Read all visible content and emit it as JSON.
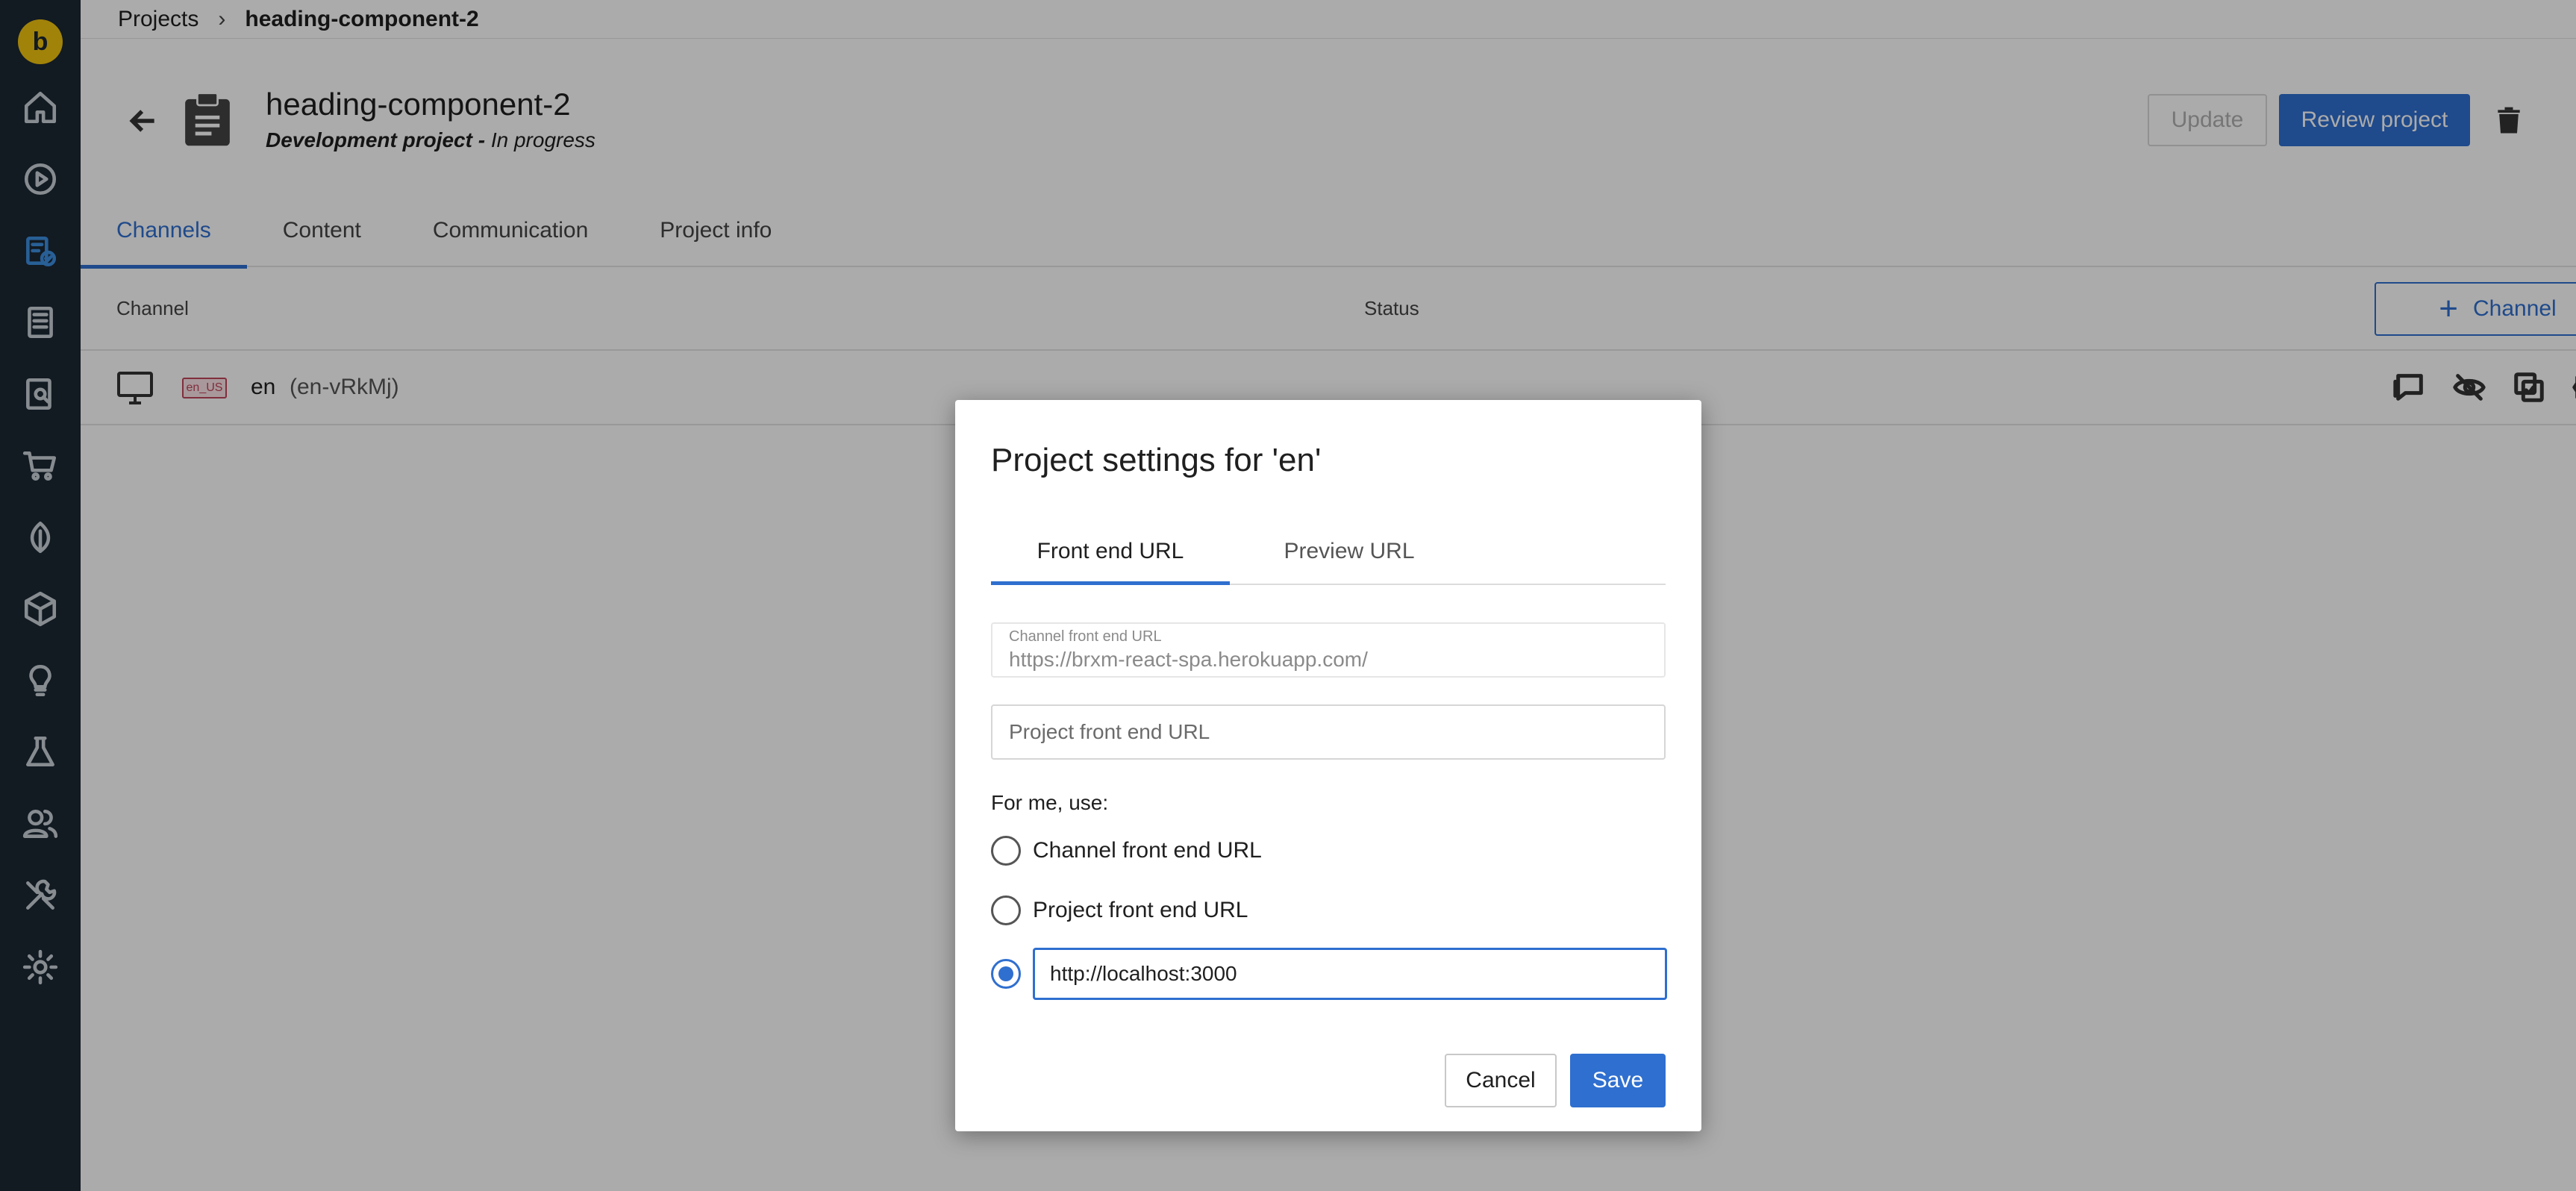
{
  "colors": {
    "accent": "#2f6fcf",
    "sidebar_bg": "#1b2733",
    "logo": "#f1c40f"
  },
  "sidebar": {
    "logo_letter": "b",
    "items": [
      {
        "icon": "home-icon"
      },
      {
        "icon": "play-icon"
      },
      {
        "icon": "projects-icon",
        "active": true
      },
      {
        "icon": "document-icon"
      },
      {
        "icon": "search-document-icon"
      },
      {
        "icon": "cart-icon"
      },
      {
        "icon": "leaf-icon"
      },
      {
        "icon": "cube-icon"
      },
      {
        "icon": "lightbulb-icon"
      },
      {
        "icon": "flask-icon"
      },
      {
        "icon": "users-icon"
      },
      {
        "icon": "tools-icon"
      },
      {
        "icon": "gear-icon"
      }
    ]
  },
  "breadcrumb": {
    "root": "Projects",
    "current": "heading-component-2"
  },
  "project": {
    "title": "heading-component-2",
    "type": "Development project -",
    "status": "In progress",
    "update_label": "Update",
    "review_label": "Review project"
  },
  "tabs": [
    "Channels",
    "Content",
    "Communication",
    "Project info"
  ],
  "table": {
    "col_channel": "Channel",
    "col_status": "Status",
    "add_channel_label": "Channel",
    "row": {
      "locale": "en_US",
      "name": "en",
      "id": "(en-vRkMj)"
    }
  },
  "modal": {
    "title": "Project settings for 'en'",
    "tabs": [
      "Front end URL",
      "Preview URL"
    ],
    "channel_field_label": "Channel front end URL",
    "channel_field_value": "https://brxm-react-spa.herokuapp.com/",
    "project_field_placeholder": "Project front end URL",
    "for_me_label": "For me, use:",
    "option_channel": "Channel front end URL",
    "option_project": "Project front end URL",
    "custom_value": "http://localhost:3000",
    "cancel_label": "Cancel",
    "save_label": "Save"
  }
}
